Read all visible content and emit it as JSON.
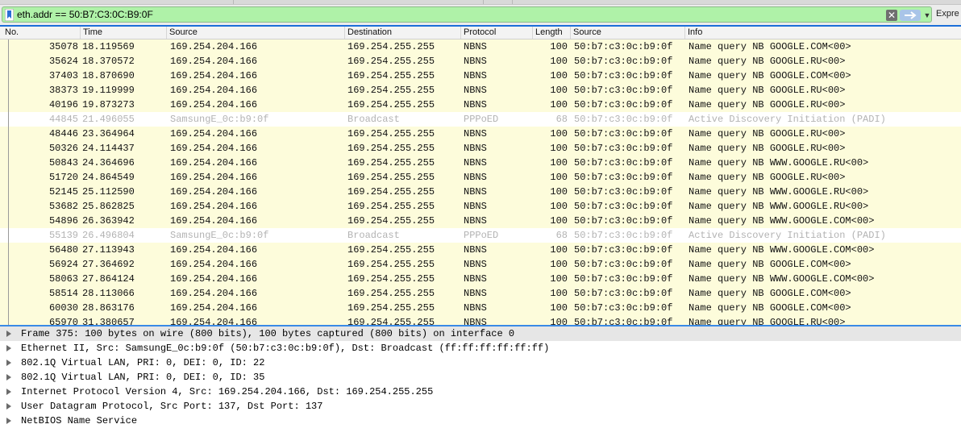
{
  "filter": {
    "value": "eth.addr == 50:B7:C3:0C:B9:0F",
    "clear_glyph": "✕",
    "dropdown_glyph": "▼",
    "expression_label": "Expre"
  },
  "columns": [
    "No.",
    "Time",
    "Source",
    "Destination",
    "Protocol",
    "Length",
    "Source",
    "Info"
  ],
  "packets": [
    {
      "no": "35078",
      "time": "18.119569",
      "src": "169.254.204.166",
      "dst": "169.254.255.255",
      "proto": "NBNS",
      "len": "100",
      "hw_src": "50:b7:c3:0c:b9:0f",
      "info": "Name query NB GOOGLE.COM<00>",
      "dim": false
    },
    {
      "no": "35624",
      "time": "18.370572",
      "src": "169.254.204.166",
      "dst": "169.254.255.255",
      "proto": "NBNS",
      "len": "100",
      "hw_src": "50:b7:c3:0c:b9:0f",
      "info": "Name query NB GOOGLE.RU<00>",
      "dim": false
    },
    {
      "no": "37403",
      "time": "18.870690",
      "src": "169.254.204.166",
      "dst": "169.254.255.255",
      "proto": "NBNS",
      "len": "100",
      "hw_src": "50:b7:c3:0c:b9:0f",
      "info": "Name query NB GOOGLE.COM<00>",
      "dim": false
    },
    {
      "no": "38373",
      "time": "19.119999",
      "src": "169.254.204.166",
      "dst": "169.254.255.255",
      "proto": "NBNS",
      "len": "100",
      "hw_src": "50:b7:c3:0c:b9:0f",
      "info": "Name query NB GOOGLE.RU<00>",
      "dim": false
    },
    {
      "no": "40196",
      "time": "19.873273",
      "src": "169.254.204.166",
      "dst": "169.254.255.255",
      "proto": "NBNS",
      "len": "100",
      "hw_src": "50:b7:c3:0c:b9:0f",
      "info": "Name query NB GOOGLE.RU<00>",
      "dim": false
    },
    {
      "no": "44845",
      "time": "21.496055",
      "src": "SamsungE_0c:b9:0f",
      "dst": "Broadcast",
      "proto": "PPPoED",
      "len": "68",
      "hw_src": "50:b7:c3:0c:b9:0f",
      "info": "Active Discovery Initiation (PADI)",
      "dim": true
    },
    {
      "no": "48446",
      "time": "23.364964",
      "src": "169.254.204.166",
      "dst": "169.254.255.255",
      "proto": "NBNS",
      "len": "100",
      "hw_src": "50:b7:c3:0c:b9:0f",
      "info": "Name query NB GOOGLE.RU<00>",
      "dim": false
    },
    {
      "no": "50326",
      "time": "24.114437",
      "src": "169.254.204.166",
      "dst": "169.254.255.255",
      "proto": "NBNS",
      "len": "100",
      "hw_src": "50:b7:c3:0c:b9:0f",
      "info": "Name query NB GOOGLE.RU<00>",
      "dim": false
    },
    {
      "no": "50843",
      "time": "24.364696",
      "src": "169.254.204.166",
      "dst": "169.254.255.255",
      "proto": "NBNS",
      "len": "100",
      "hw_src": "50:b7:c3:0c:b9:0f",
      "info": "Name query NB WWW.GOOGLE.RU<00>",
      "dim": false
    },
    {
      "no": "51720",
      "time": "24.864549",
      "src": "169.254.204.166",
      "dst": "169.254.255.255",
      "proto": "NBNS",
      "len": "100",
      "hw_src": "50:b7:c3:0c:b9:0f",
      "info": "Name query NB GOOGLE.RU<00>",
      "dim": false
    },
    {
      "no": "52145",
      "time": "25.112590",
      "src": "169.254.204.166",
      "dst": "169.254.255.255",
      "proto": "NBNS",
      "len": "100",
      "hw_src": "50:b7:c3:0c:b9:0f",
      "info": "Name query NB WWW.GOOGLE.RU<00>",
      "dim": false
    },
    {
      "no": "53682",
      "time": "25.862825",
      "src": "169.254.204.166",
      "dst": "169.254.255.255",
      "proto": "NBNS",
      "len": "100",
      "hw_src": "50:b7:c3:0c:b9:0f",
      "info": "Name query NB WWW.GOOGLE.RU<00>",
      "dim": false
    },
    {
      "no": "54896",
      "time": "26.363942",
      "src": "169.254.204.166",
      "dst": "169.254.255.255",
      "proto": "NBNS",
      "len": "100",
      "hw_src": "50:b7:c3:0c:b9:0f",
      "info": "Name query NB WWW.GOOGLE.COM<00>",
      "dim": false
    },
    {
      "no": "55139",
      "time": "26.496804",
      "src": "SamsungE_0c:b9:0f",
      "dst": "Broadcast",
      "proto": "PPPoED",
      "len": "68",
      "hw_src": "50:b7:c3:0c:b9:0f",
      "info": "Active Discovery Initiation (PADI)",
      "dim": true
    },
    {
      "no": "56480",
      "time": "27.113943",
      "src": "169.254.204.166",
      "dst": "169.254.255.255",
      "proto": "NBNS",
      "len": "100",
      "hw_src": "50:b7:c3:0c:b9:0f",
      "info": "Name query NB WWW.GOOGLE.COM<00>",
      "dim": false
    },
    {
      "no": "56924",
      "time": "27.364692",
      "src": "169.254.204.166",
      "dst": "169.254.255.255",
      "proto": "NBNS",
      "len": "100",
      "hw_src": "50:b7:c3:0c:b9:0f",
      "info": "Name query NB GOOGLE.COM<00>",
      "dim": false
    },
    {
      "no": "58063",
      "time": "27.864124",
      "src": "169.254.204.166",
      "dst": "169.254.255.255",
      "proto": "NBNS",
      "len": "100",
      "hw_src": "50:b7:c3:0c:b9:0f",
      "info": "Name query NB WWW.GOOGLE.COM<00>",
      "dim": false
    },
    {
      "no": "58514",
      "time": "28.113066",
      "src": "169.254.204.166",
      "dst": "169.254.255.255",
      "proto": "NBNS",
      "len": "100",
      "hw_src": "50:b7:c3:0c:b9:0f",
      "info": "Name query NB GOOGLE.COM<00>",
      "dim": false
    },
    {
      "no": "60030",
      "time": "28.863176",
      "src": "169.254.204.166",
      "dst": "169.254.255.255",
      "proto": "NBNS",
      "len": "100",
      "hw_src": "50:b7:c3:0c:b9:0f",
      "info": "Name query NB GOOGLE.COM<00>",
      "dim": false
    },
    {
      "no": "65970",
      "time": "31.380657",
      "src": "169.254.204.166",
      "dst": "169.254.255.255",
      "proto": "NBNS",
      "len": "100",
      "hw_src": "50:b7:c3:0c:b9:0f",
      "info": "Name query NB GOOGLE.RU<00>",
      "dim": false
    }
  ],
  "details": [
    {
      "text": "Frame 375: 100 bytes on wire (800 bits), 100 bytes captured (800 bits) on interface 0",
      "selected": true
    },
    {
      "text": "Ethernet II, Src: SamsungE_0c:b9:0f (50:b7:c3:0c:b9:0f), Dst: Broadcast (ff:ff:ff:ff:ff:ff)",
      "selected": false
    },
    {
      "text": "802.1Q Virtual LAN, PRI: 0, DEI: 0, ID: 22",
      "selected": false
    },
    {
      "text": "802.1Q Virtual LAN, PRI: 0, DEI: 0, ID: 35",
      "selected": false
    },
    {
      "text": "Internet Protocol Version 4, Src: 169.254.204.166, Dst: 169.254.255.255",
      "selected": false
    },
    {
      "text": "User Datagram Protocol, Src Port: 137, Dst Port: 137",
      "selected": false
    },
    {
      "text": "NetBIOS Name Service",
      "selected": false
    }
  ],
  "colors": {
    "filter_valid": "#aff2a8",
    "row_normal": "#fdfcdb",
    "row_dim_text": "#b3b3b3",
    "accent": "#1c6fd9"
  }
}
